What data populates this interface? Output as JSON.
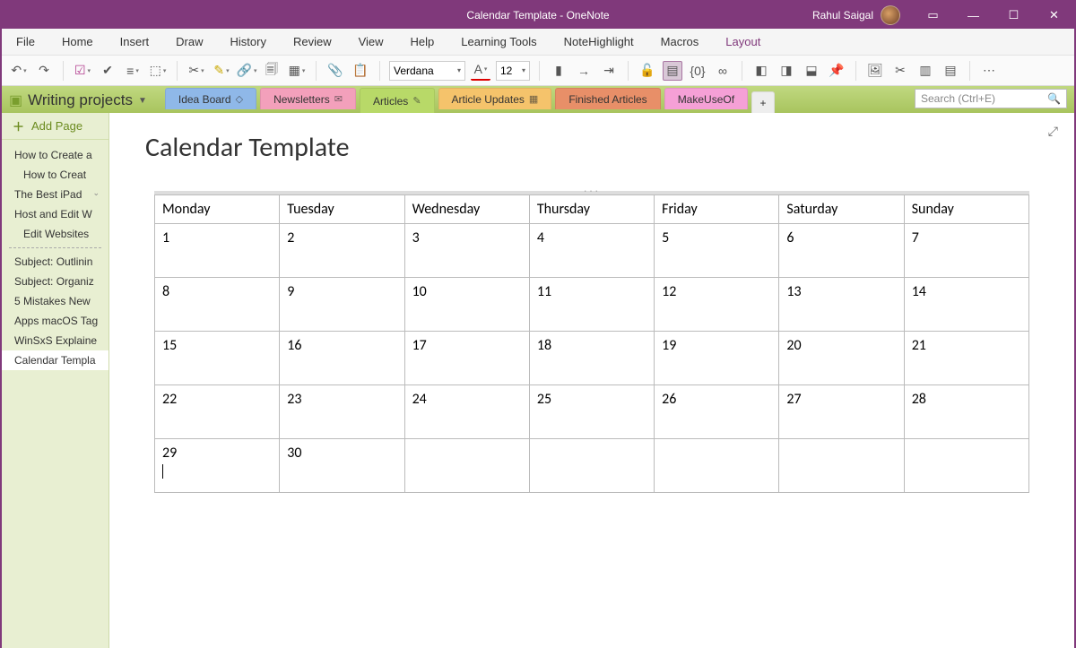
{
  "window": {
    "title": "Calendar Template  -  OneNote",
    "user": "Rahul Saigal"
  },
  "menu": [
    "File",
    "Home",
    "Insert",
    "Draw",
    "History",
    "Review",
    "View",
    "Help",
    "Learning Tools",
    "NoteHighlight",
    "Macros",
    "Layout"
  ],
  "menu_active_index": 11,
  "toolbar": {
    "font": "Verdana",
    "size": "12"
  },
  "notebook": "Writing projects",
  "sections": [
    {
      "label": "Idea Board",
      "cls": "tab-ideas",
      "icon": "◇"
    },
    {
      "label": "Newsletters",
      "cls": "tab-news",
      "icon": "✉"
    },
    {
      "label": "Articles",
      "cls": "tab-art",
      "icon": "✎",
      "active": true
    },
    {
      "label": "Article Updates",
      "cls": "tab-upd",
      "icon": "▦"
    },
    {
      "label": "Finished Articles",
      "cls": "tab-fin",
      "icon": ""
    },
    {
      "label": "MakeUseOf",
      "cls": "tab-muo",
      "icon": ""
    }
  ],
  "search_placeholder": "Search (Ctrl+E)",
  "sidebar": {
    "add_label": "Add Page",
    "pages_top": [
      {
        "t": "How to Create a"
      },
      {
        "t": "How to Creat",
        "indent": true
      },
      {
        "t": "The Best iPad",
        "chev": true
      },
      {
        "t": "Host and Edit W"
      },
      {
        "t": "Edit Websites",
        "indent": true
      }
    ],
    "pages_bottom": [
      {
        "t": "Subject: Outlinin"
      },
      {
        "t": "Subject: Organiz"
      },
      {
        "t": "5 Mistakes New"
      },
      {
        "t": "Apps macOS Tag"
      },
      {
        "t": "WinSxS Explaine"
      },
      {
        "t": "Calendar Templa",
        "sel": true
      }
    ]
  },
  "page": {
    "title": "Calendar Template",
    "days": [
      "Monday",
      "Tuesday",
      "Wednesday",
      "Thursday",
      "Friday",
      "Saturday",
      "Sunday"
    ],
    "weeks": [
      [
        "1",
        "2",
        "3",
        "4",
        "5",
        "6",
        "7"
      ],
      [
        "8",
        "9",
        "10",
        "11",
        "12",
        "13",
        "14"
      ],
      [
        "15",
        "16",
        "17",
        "18",
        "19",
        "20",
        "21"
      ],
      [
        "22",
        "23",
        "24",
        "25",
        "26",
        "27",
        "28"
      ],
      [
        "29",
        "30",
        "",
        "",
        "",
        "",
        ""
      ]
    ]
  }
}
